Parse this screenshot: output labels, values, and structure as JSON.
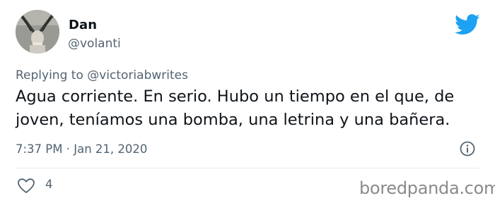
{
  "tweet": {
    "author_name": "Dan",
    "author_handle": "@volanti",
    "replying_prefix": "Replying to",
    "replying_to": "@victoriabwrites",
    "text_line1": "Agua corriente. En serio. Hubo un tiempo en el que, de",
    "text_line2": "joven, teníamos una bomba, una letrina y una bañera.",
    "timestamp": "7:37 PM · Jan 21, 2020",
    "like_count": "4"
  },
  "icons": {
    "platform": "twitter-bird-icon",
    "info": "info-icon",
    "like": "heart-icon"
  },
  "watermark": "boredpanda.com",
  "colors": {
    "brand": "#1da1f2",
    "text": "#0f1419",
    "secondary": "#536471"
  }
}
